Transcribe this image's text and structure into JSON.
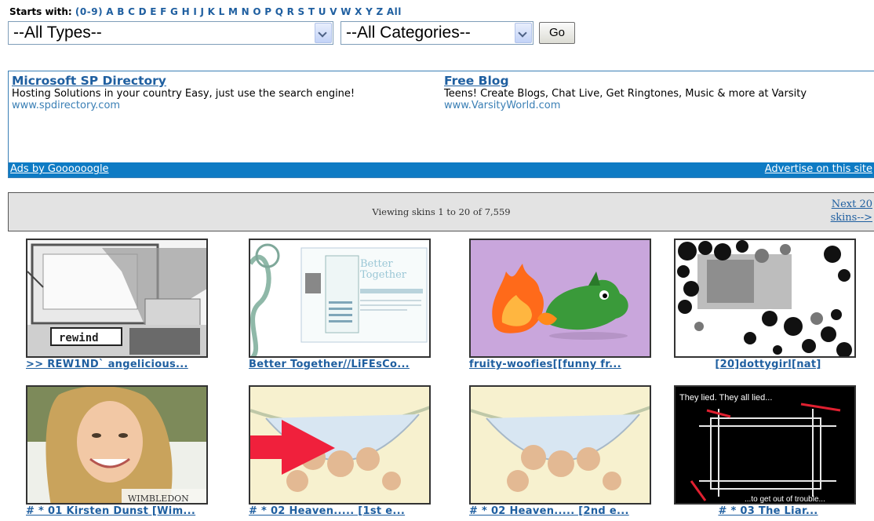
{
  "filter": {
    "label": "Starts with:",
    "letters": [
      "(0-9)",
      "A",
      "B",
      "C",
      "D",
      "E",
      "F",
      "G",
      "H",
      "I",
      "J",
      "K",
      "L",
      "M",
      "N",
      "O",
      "P",
      "Q",
      "R",
      "S",
      "T",
      "U",
      "V",
      "W",
      "X",
      "Y",
      "Z",
      "All"
    ],
    "type_select": "--All Types--",
    "category_select": "--All Categories--",
    "go_label": "Go"
  },
  "ads": {
    "items": [
      {
        "title": "Microsoft SP Directory",
        "text": "Hosting Solutions in your country Easy, just use the search engine!",
        "url": "www.spdirectory.com"
      },
      {
        "title": "Free Blog",
        "text": "Teens! Create Blogs, Chat Live, Get Ringtones, Music & more at Varsity",
        "url": "www.VarsityWorld.com"
      }
    ],
    "ads_by": "Ads by Goooooogle",
    "advertise": "Advertise on this site"
  },
  "paging": {
    "viewing": "Viewing skins 1 to 20 of 7,559",
    "next_line1": "Next 20",
    "next_line2": "skins-->"
  },
  "skins": [
    {
      "caption": ">> REW1ND` angelicious...",
      "thumb_icon": "rewind-collage-thumbnail"
    },
    {
      "caption": "Better Together//LiFEsCo...",
      "thumb_icon": "blog-layout-thumbnail"
    },
    {
      "caption": "fruity-woofies[[funny fr...",
      "thumb_icon": "fruit-creatures-thumbnail"
    },
    {
      "caption": "[20]dottygirl[nat]",
      "thumb_icon": "dotty-circles-thumbnail"
    },
    {
      "caption": "# * 01 Kirsten Dunst [Wim...",
      "thumb_icon": "kirsten-dunst-thumbnail",
      "thumb_text": "WIMBLEDON"
    },
    {
      "caption": "# * 02 Heaven..... [1st e...",
      "thumb_icon": "heaven-hammock-arrow-thumbnail"
    },
    {
      "caption": "# * 02 Heaven..... [2nd e...",
      "thumb_icon": "heaven-hammock-thumbnail"
    },
    {
      "caption": "# * 03 The Liar...",
      "thumb_icon": "the-liar-thumbnail",
      "thumb_text_top": "They lied. They all lied...",
      "thumb_text_bottom": "...to get out of trouble..."
    }
  ],
  "colors": {
    "link": "#1f5fa0",
    "ad_bar": "#0e7bc4",
    "paging_bg": "#e3e3e3"
  }
}
